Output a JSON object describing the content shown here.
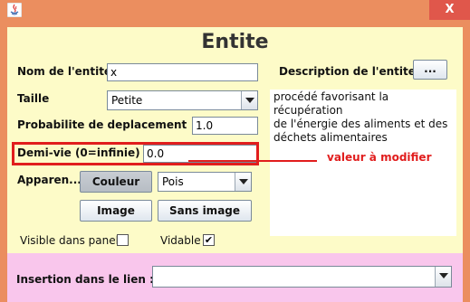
{
  "window": {
    "title": "",
    "close_glyph": "X"
  },
  "heading": "Entite",
  "fields": {
    "nom_label": "Nom de l'entite",
    "nom_value": "x",
    "taille_label": "Taille",
    "taille_value": "Petite",
    "proba_label": "Probabilite de deplacement",
    "proba_value": "1.0",
    "demivie_label": "Demi-vie (0=infinie)",
    "demivie_value": "0.0",
    "apparence_label": "Apparen...",
    "apparence_value": "Pois"
  },
  "buttons": {
    "couleur": "Couleur",
    "image": "Image",
    "sans_image": "Sans image",
    "description_edit": "..."
  },
  "description": {
    "label": "Description de l'entite",
    "text": "procédé favorisant la récupération\n de l'énergie des aliments et des\ndéchets alimentaires"
  },
  "checkboxes": {
    "visible_label": "Visible dans panel",
    "visible_checked": false,
    "vidable_label": "Vidable",
    "vidable_checked": true,
    "check_glyph": "✔"
  },
  "insertion": {
    "label": "Insertion dans le lien :",
    "value": ""
  },
  "annotation": {
    "text": "valeur à modifier",
    "color": "#e11d1d"
  },
  "colors": {
    "window_frame": "#eb8e5f",
    "panel": "#fdfbc8",
    "bottom_panel": "#f9c6ec",
    "close_button": "#e0574b"
  }
}
